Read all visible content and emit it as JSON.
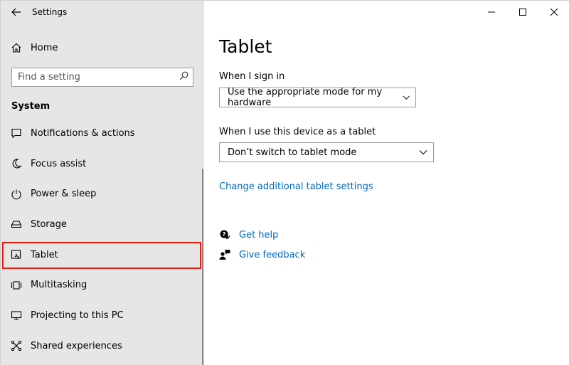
{
  "window": {
    "title": "Settings"
  },
  "sidebar": {
    "home_label": "Home",
    "search_placeholder": "Find a setting",
    "section_header": "System",
    "items": [
      {
        "label": "Notifications & actions",
        "icon": "notifications-icon"
      },
      {
        "label": "Focus assist",
        "icon": "moon-icon"
      },
      {
        "label": "Power & sleep",
        "icon": "power-icon"
      },
      {
        "label": "Storage",
        "icon": "storage-icon"
      },
      {
        "label": "Tablet",
        "icon": "tablet-icon",
        "selected": true
      },
      {
        "label": "Multitasking",
        "icon": "multitasking-icon"
      },
      {
        "label": "Projecting to this PC",
        "icon": "projecting-icon"
      },
      {
        "label": "Shared experiences",
        "icon": "shared-icon"
      }
    ]
  },
  "main": {
    "title": "Tablet",
    "sign_in_label": "When I sign in",
    "sign_in_value": "Use the appropriate mode for my hardware",
    "tablet_use_label": "When I use this device as a tablet",
    "tablet_use_value": "Don’t switch to tablet mode",
    "additional_link": "Change additional tablet settings",
    "help_label": "Get help",
    "feedback_label": "Give feedback"
  },
  "colors": {
    "accent_link": "#0067b8",
    "selection_outline": "#e81b0e",
    "sidebar_bg": "#e6e6e6"
  }
}
